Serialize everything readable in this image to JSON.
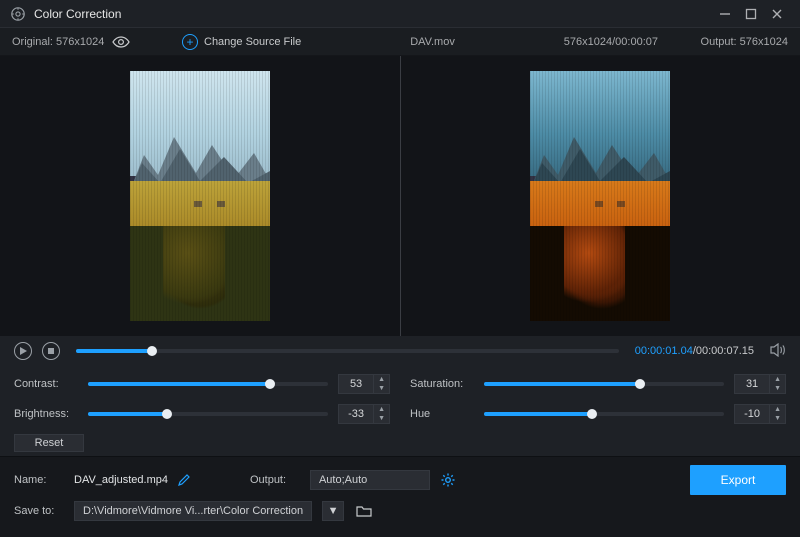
{
  "window": {
    "title": "Color Correction"
  },
  "subheader": {
    "original_label": "Original: 576x1024",
    "change_source_label": "Change Source File",
    "filename": "DAV.mov",
    "dims_time": "576x1024/00:00:07",
    "output_label": "Output: 576x1024"
  },
  "transport": {
    "current_time": "00:00:01.04",
    "total_time": "/00:00:07.15",
    "progress_pct": 14
  },
  "adjust": {
    "contrast": {
      "label": "Contrast:",
      "value": "53",
      "pct": 76
    },
    "saturation": {
      "label": "Saturation:",
      "value": "31",
      "pct": 65
    },
    "brightness": {
      "label": "Brightness:",
      "value": "-33",
      "pct": 33
    },
    "hue": {
      "label": "Hue",
      "value": "-10",
      "pct": 45
    },
    "reset_label": "Reset"
  },
  "footer": {
    "name_label": "Name:",
    "name_value": "DAV_adjusted.mp4",
    "output_label": "Output:",
    "output_value": "Auto;Auto",
    "save_label": "Save to:",
    "save_path": "D:\\Vidmore\\Vidmore Vi...rter\\Color Correction",
    "export_label": "Export"
  }
}
